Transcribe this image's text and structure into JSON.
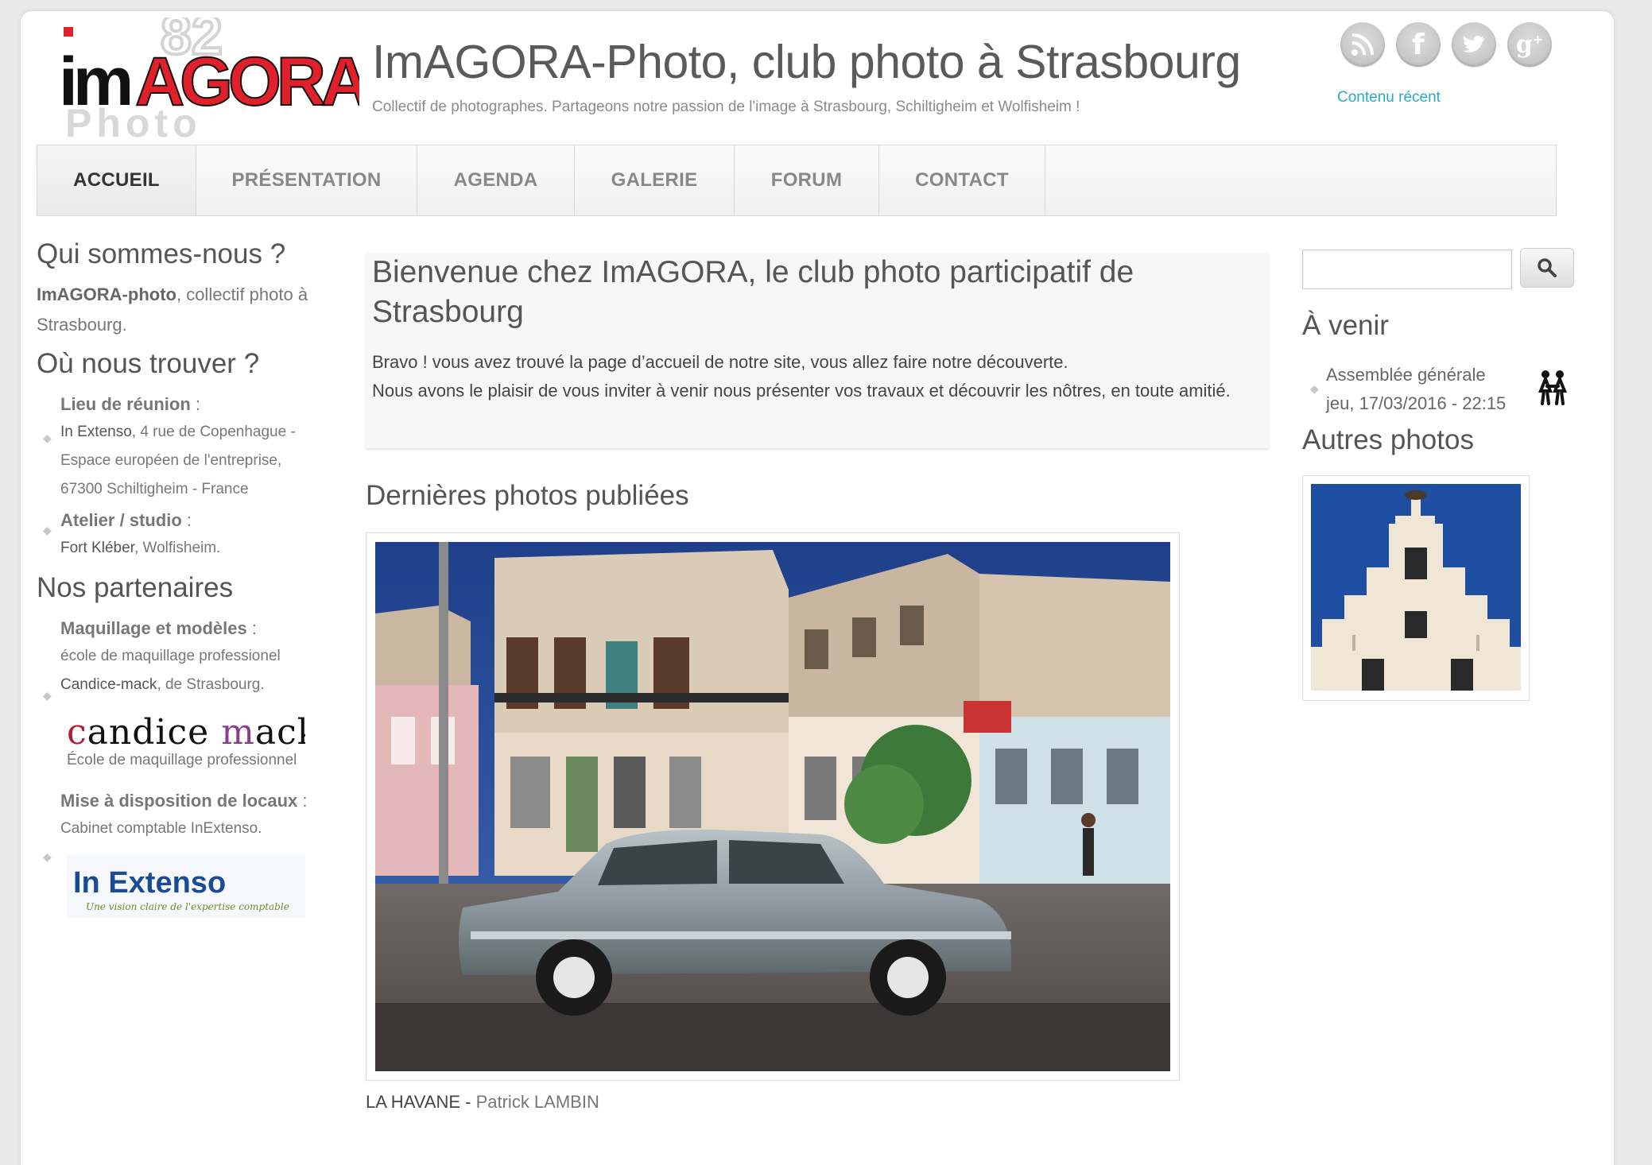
{
  "header": {
    "site_title": "ImAGORA-Photo, club photo à Strasbourg",
    "slogan": "Collectif de photographes. Partageons notre passion de l'image à Strasbourg, Schiltigheim et Wolfisheim !",
    "logo": {
      "main": "imAGORA",
      "sub": "Photo"
    },
    "social": [
      {
        "name": "rss-icon",
        "glyph": "◉"
      },
      {
        "name": "facebook-icon",
        "glyph": "f"
      },
      {
        "name": "twitter-icon",
        "glyph": "t"
      },
      {
        "name": "googleplus-icon",
        "glyph": "g+"
      }
    ],
    "recent_link": "Contenu récent"
  },
  "nav": {
    "items": [
      {
        "label": "ACCUEIL",
        "active": true
      },
      {
        "label": "PRÉSENTATION",
        "active": false
      },
      {
        "label": "AGENDA",
        "active": false
      },
      {
        "label": "GALERIE",
        "active": false
      },
      {
        "label": "FORUM",
        "active": false
      },
      {
        "label": "CONTACT",
        "active": false
      }
    ]
  },
  "left": {
    "who_title": "Qui sommes-nous ?",
    "who_strong": "ImAGORA-photo",
    "who_text": ", collectif photo à Strasbourg.",
    "where_title": "Où nous trouver ?",
    "meeting_head": "Lieu de réunion",
    "meeting_colon": " :",
    "meeting_place": "In Extenso",
    "meeting_address": ", 4 rue de Copenhague - Espace européen de l'entreprise, 67300 Schiltigheim - France",
    "studio_head": "Atelier / studio",
    "studio_colon": " :",
    "studio_place": "Fort Kléber",
    "studio_text": ", Wolfisheim.",
    "partners_title": "Nos partenaires",
    "makeup_head": "Maquillage et modèles",
    "makeup_colon": " :",
    "makeup_text1": "école de maquillage professionel",
    "makeup_text2_strong": "Candice-mack",
    "makeup_text2": ", de Strasbourg.",
    "candice_logo": {
      "main": "candice mack",
      "sub": "École de maquillage professionnel"
    },
    "premises_head": "Mise à disposition de locaux",
    "premises_colon": " :",
    "premises_text": "Cabinet comptable InExtenso.",
    "inextenso_logo": {
      "main": "In Extenso",
      "sub": "Une vision claire de l'expertise comptable"
    }
  },
  "main": {
    "welcome_title": "Bienvenue chez ImAGORA, le club photo participatif de Strasbourg",
    "welcome_line1": "Bravo ! vous avez trouvé la page d’accueil de notre site, vous allez faire notre découverte.",
    "welcome_line2": "Nous avons le plaisir de vous inviter à venir nous présenter vos travaux et découvrir les nôtres, en toute amitié.",
    "latest_title": "Dernières photos publiées",
    "photo_title": "LA HAVANE",
    "photo_sep": " - ",
    "photo_author": "Patrick LAMBIN"
  },
  "right": {
    "search_value": "",
    "upcoming_title": "À venir",
    "event_name": "Assemblée générale",
    "event_date": "jeu, 17/03/2016 - 22:15",
    "other_photos_title": "Autres photos"
  },
  "colors": {
    "accent_link": "#2aa8c9",
    "logo_red": "#e0202a",
    "nav_active": "#333333"
  }
}
